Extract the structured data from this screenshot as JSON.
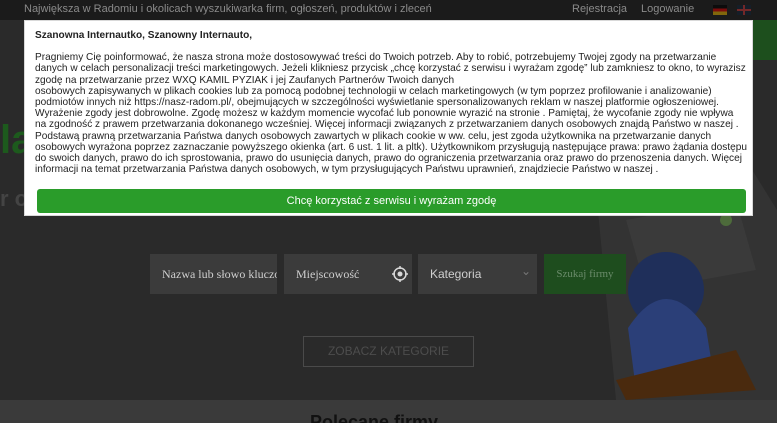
{
  "topbar": {
    "tagline": "Największa w Radomiu i okolicach wyszukiwarka firm, ogłoszeń, produktów i zleceń",
    "register_label": "Rejestracja",
    "login_label": "Logowanie",
    "languages": [
      "de",
      "en"
    ]
  },
  "hero": {
    "left_text_1": "la",
    "left_text_2": "r og",
    "search": {
      "name_placeholder": "Nazwa lub słowo kluczowe",
      "city_placeholder": "Miejscowość",
      "category_selected": "Kategoria",
      "button_label": "Szukaj firmy"
    },
    "categories_button": "ZOBACZ KATEGORIE",
    "section_title": "Polecane firmy"
  },
  "consent": {
    "greeting": "Szanowna Internautko, Szanowny Internauto,",
    "paragraph_1": "Pragniemy Cię poinformować, że nasza strona może dostosowywać treści do Twoich potrzeb. Aby to robić, potrzebujemy Twojej zgody na przetwarzanie danych w celach personalizacji treści marketingowych. Jeżeli klikniesz przycisk „chcę korzystać z serwisu i wyrażam zgodę” lub zamkniesz to okno, to wyrazisz zgodę na przetwarzanie przez WXQ KAMIL PYZIAK i jej Zaufanych Partnerów Twoich danych",
    "paragraph_2": "osobowych zapisywanych w plikach cookies lub za pomocą podobnej technologii w celach marketingowych (w tym poprzez profilowanie i analizowanie) podmiotów innych niż https://nasz-radom.pl/, obejmujących w szczególności wyświetlanie spersonalizowanych reklam w naszej platformie ogłoszeniowej.",
    "paragraph_3": "Wyrażenie zgody jest dobrowolne. Zgodę możesz w każdym momencie wycofać lub ponownie wyrazić na stronie                                             . Pamiętaj, że wycofanie zgody nie wpływa na zgodność z prawem przetwarzania dokonanego wcześniej. Więcej informacji związanych z przetwarzaniem danych osobowych znajdą Państwo w naszej                                     . Podstawą prawną przetwarzania Państwa danych osobowych zawartych w plikach cookie w ww. celu, jest zgoda użytkownika na przetwarzanie danych osobowych wyrażona poprzez zaznaczanie powyższego okienka (art. 6 ust. 1 lit. a pltk). Użytkownikom przysługują następujące prawa: prawo żądania dostępu do swoich danych, prawo do ich sprostowania, prawo do usunięcia danych, prawo do ograniczenia przetwarzania oraz prawo do przenoszenia danych. Więcej informacji na temat przetwarzania Państwa danych osobowych, w tym przysługujących Państwu uprawnień, znajdziecie Państwo w naszej                              .",
    "accept_button": "Chcę korzystać z serwisu i wyrażam zgodę"
  },
  "colors": {
    "accept_green": "#2a9c2a",
    "overlay_dark": "#2c2c2c"
  }
}
